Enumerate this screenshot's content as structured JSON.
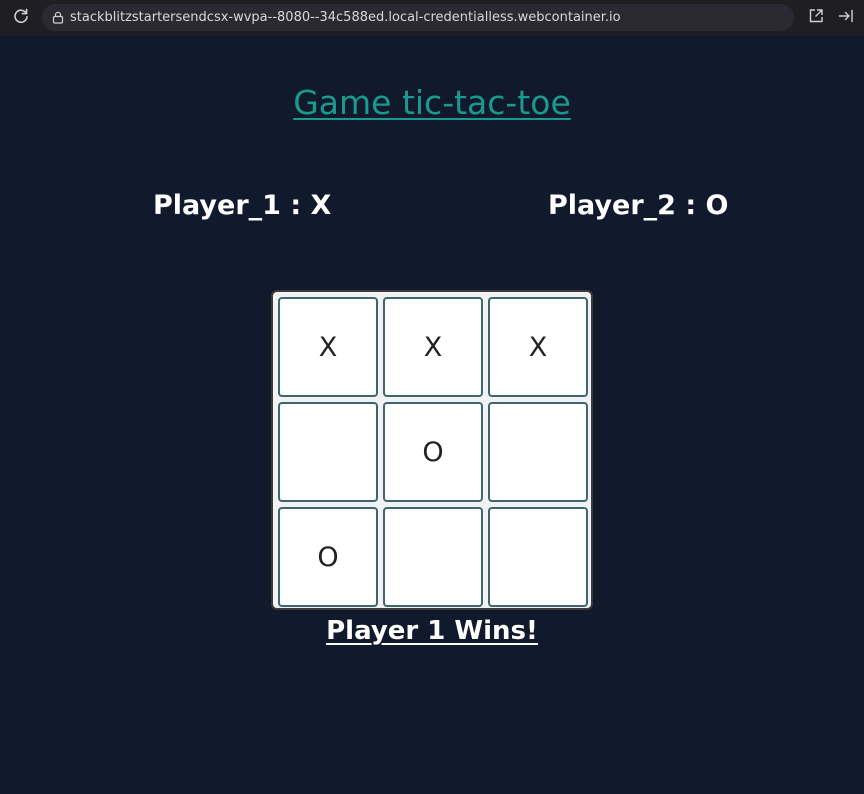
{
  "browser": {
    "url": "stackblitzstartersendcsx-wvpa--8080--34c588ed.local-credentialless.webcontainer.io"
  },
  "game": {
    "title": "Game tic-tac-toe",
    "player1_label": "Player_1 : X",
    "player2_label": "Player_2 : O",
    "board": [
      "X",
      "X",
      "X",
      "",
      "O",
      "",
      "O",
      "",
      ""
    ],
    "result": "Player 1 Wins!"
  },
  "colors": {
    "background": "#111a2c",
    "title": "#1a9a8e",
    "cell_border": "#3d6671"
  },
  "icons": {
    "reload": "reload-icon",
    "lock": "lock-icon",
    "open_in_new_tab": "open-in-new-tab-icon",
    "sidebar": "sidebar-collapse-icon"
  }
}
